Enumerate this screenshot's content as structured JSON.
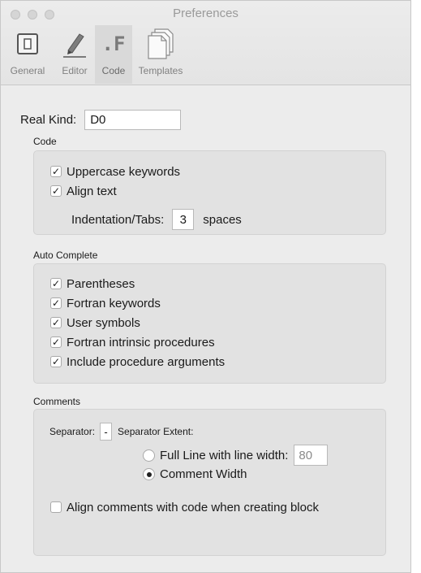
{
  "window": {
    "title": "Preferences"
  },
  "toolbar": {
    "tabs": [
      {
        "label": "General",
        "icon": "switch-icon"
      },
      {
        "label": "Editor",
        "icon": "pen-icon"
      },
      {
        "label": "Code",
        "icon": "fortran-f-icon",
        "active": true,
        "icon_text": ".F"
      },
      {
        "label": "Templates",
        "icon": "documents-icon"
      }
    ]
  },
  "real_kind": {
    "label": "Real Kind:",
    "value": "D0"
  },
  "code": {
    "title": "Code",
    "options": [
      {
        "label": "Uppercase keywords",
        "checked": true
      },
      {
        "label": "Align text",
        "checked": true
      }
    ],
    "indentation": {
      "label": "Indentation/Tabs:",
      "value": "3",
      "unit": "spaces"
    }
  },
  "auto_complete": {
    "title": "Auto Complete",
    "options": [
      {
        "label": "Parentheses",
        "checked": true
      },
      {
        "label": "Fortran keywords",
        "checked": true
      },
      {
        "label": "User symbols",
        "checked": true
      },
      {
        "label": "Fortran intrinsic procedures",
        "checked": true
      },
      {
        "label": "Include procedure arguments",
        "checked": true
      }
    ]
  },
  "comments": {
    "title": "Comments",
    "separator_label": "Separator:",
    "separator_value": "-",
    "extent_label": "Separator Extent:",
    "full_line_label": "Full Line with line width:",
    "line_width": "80",
    "comment_width_label": "Comment Width",
    "selected_extent": "Comment Width",
    "align_label": "Align comments with code when creating block",
    "align_checked": false
  },
  "check_mark": "✓"
}
